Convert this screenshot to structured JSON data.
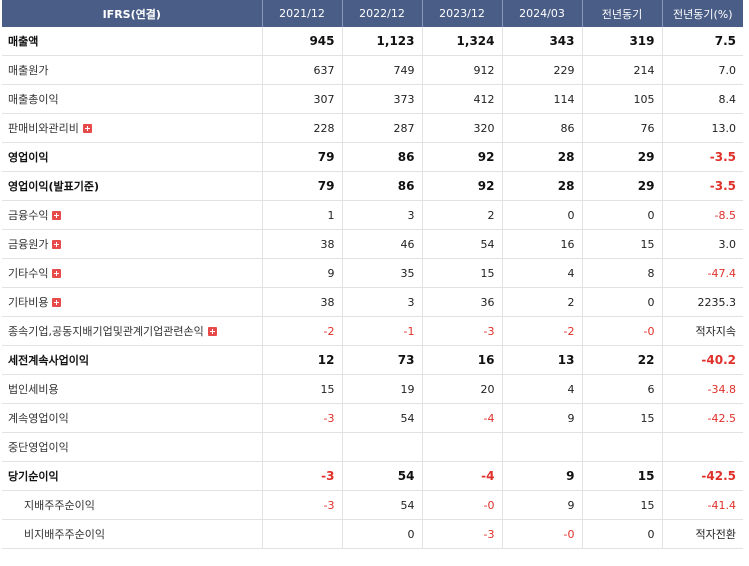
{
  "headers": [
    "IFRS(연결)",
    "2021/12",
    "2022/12",
    "2023/12",
    "2024/03",
    "전년동기",
    "전년동기(%)"
  ],
  "rows": [
    {
      "label": "매출액",
      "bold": true,
      "expand": false,
      "indent": false,
      "values": [
        "945",
        "1,123",
        "1,324",
        "343",
        "319",
        "7.5"
      ]
    },
    {
      "label": "매출원가",
      "bold": false,
      "expand": false,
      "indent": false,
      "values": [
        "637",
        "749",
        "912",
        "229",
        "214",
        "7.0"
      ]
    },
    {
      "label": "매출총이익",
      "bold": false,
      "expand": false,
      "indent": false,
      "values": [
        "307",
        "373",
        "412",
        "114",
        "105",
        "8.4"
      ]
    },
    {
      "label": "판매비와관리비",
      "bold": false,
      "expand": true,
      "indent": false,
      "values": [
        "228",
        "287",
        "320",
        "86",
        "76",
        "13.0"
      ]
    },
    {
      "label": "영업이익",
      "bold": true,
      "expand": false,
      "indent": false,
      "values": [
        "79",
        "86",
        "92",
        "28",
        "29",
        "-3.5"
      ]
    },
    {
      "label": "영업이익(발표기준)",
      "bold": true,
      "expand": false,
      "indent": false,
      "values": [
        "79",
        "86",
        "92",
        "28",
        "29",
        "-3.5"
      ]
    },
    {
      "label": "금융수익",
      "bold": false,
      "expand": true,
      "indent": false,
      "values": [
        "1",
        "3",
        "2",
        "0",
        "0",
        "-8.5"
      ]
    },
    {
      "label": "금융원가",
      "bold": false,
      "expand": true,
      "indent": false,
      "values": [
        "38",
        "46",
        "54",
        "16",
        "15",
        "3.0"
      ]
    },
    {
      "label": "기타수익",
      "bold": false,
      "expand": true,
      "indent": false,
      "values": [
        "9",
        "35",
        "15",
        "4",
        "8",
        "-47.4"
      ]
    },
    {
      "label": "기타비용",
      "bold": false,
      "expand": true,
      "indent": false,
      "values": [
        "38",
        "3",
        "36",
        "2",
        "0",
        "2235.3"
      ]
    },
    {
      "label": "종속기업,공동지배기업및관계기업관련손익",
      "bold": false,
      "expand": true,
      "indent": false,
      "values": [
        "-2",
        "-1",
        "-3",
        "-2",
        "-0",
        "적자지속"
      ]
    },
    {
      "label": "세전계속사업이익",
      "bold": true,
      "expand": false,
      "indent": false,
      "values": [
        "12",
        "73",
        "16",
        "13",
        "22",
        "-40.2"
      ]
    },
    {
      "label": "법인세비용",
      "bold": false,
      "expand": false,
      "indent": false,
      "values": [
        "15",
        "19",
        "20",
        "4",
        "6",
        "-34.8"
      ]
    },
    {
      "label": "계속영업이익",
      "bold": false,
      "expand": false,
      "indent": false,
      "values": [
        "-3",
        "54",
        "-4",
        "9",
        "15",
        "-42.5"
      ]
    },
    {
      "label": "중단영업이익",
      "bold": false,
      "expand": false,
      "indent": false,
      "values": [
        "",
        "",
        "",
        "",
        "",
        ""
      ]
    },
    {
      "label": "당기순이익",
      "bold": true,
      "expand": false,
      "indent": false,
      "values": [
        "-3",
        "54",
        "-4",
        "9",
        "15",
        "-42.5"
      ]
    },
    {
      "label": "지배주주순이익",
      "bold": false,
      "expand": false,
      "indent": true,
      "values": [
        "-3",
        "54",
        "-0",
        "9",
        "15",
        "-41.4"
      ]
    },
    {
      "label": "비지배주주순이익",
      "bold": false,
      "expand": false,
      "indent": true,
      "values": [
        "",
        "0",
        "-3",
        "-0",
        "0",
        "적자전환"
      ]
    }
  ],
  "colors": {
    "header_bg": "#4a5d86",
    "negative": "#e0302a"
  }
}
